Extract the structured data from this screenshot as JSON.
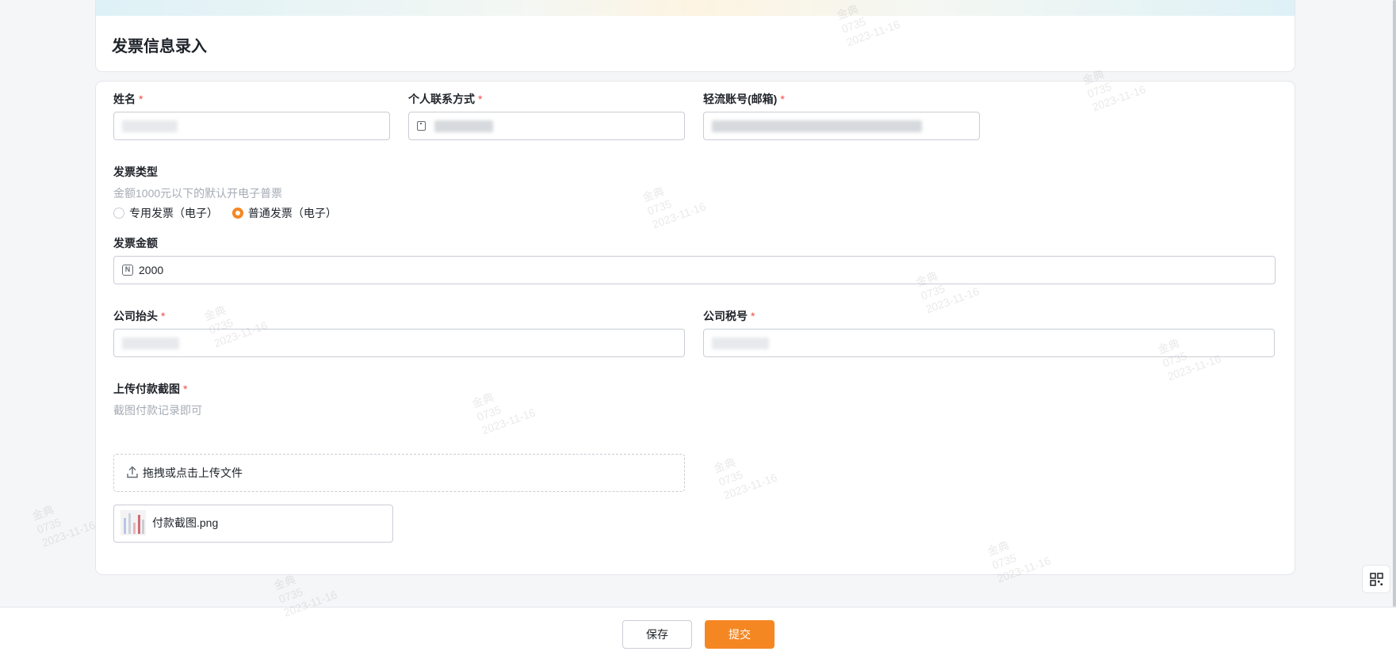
{
  "page": {
    "title": "发票信息录入"
  },
  "form": {
    "name": {
      "label": "姓名",
      "required_mark": "*",
      "value": ""
    },
    "contact": {
      "label": "个人联系方式",
      "required_mark": "*",
      "value": ""
    },
    "account": {
      "label": "轻流账号(邮箱)",
      "required_mark": "*",
      "value": ""
    },
    "invoice_type": {
      "label": "发票类型",
      "hint": "金额1000元以下的默认开电子普票",
      "options": [
        "专用发票（电子）",
        "普通发票（电子）"
      ],
      "selected": "普通发票（电子）"
    },
    "amount": {
      "label": "发票金额",
      "icon_text": "N",
      "value": "2000"
    },
    "company_title": {
      "label": "公司抬头",
      "required_mark": "*",
      "value": ""
    },
    "tax_id": {
      "label": "公司税号",
      "required_mark": "*",
      "value": ""
    },
    "upload": {
      "label": "上传付款截图",
      "required_mark": "*",
      "hint": "截图付款记录即可",
      "dropzone_text": "拖拽或点击上传文件",
      "files": [
        {
          "name": "付款截图.png"
        }
      ]
    }
  },
  "footer": {
    "save_label": "保存",
    "submit_label": "提交"
  },
  "colors": {
    "accent": "#f58723",
    "required": "#f54a45"
  },
  "icons": {
    "contact_field": "phone-icon",
    "amount_field": "number-icon",
    "upload": "upload-icon",
    "floating": "qr-code-icon"
  },
  "watermark": {
    "lines": [
      "金典",
      "0735",
      "2023-11-16"
    ]
  }
}
